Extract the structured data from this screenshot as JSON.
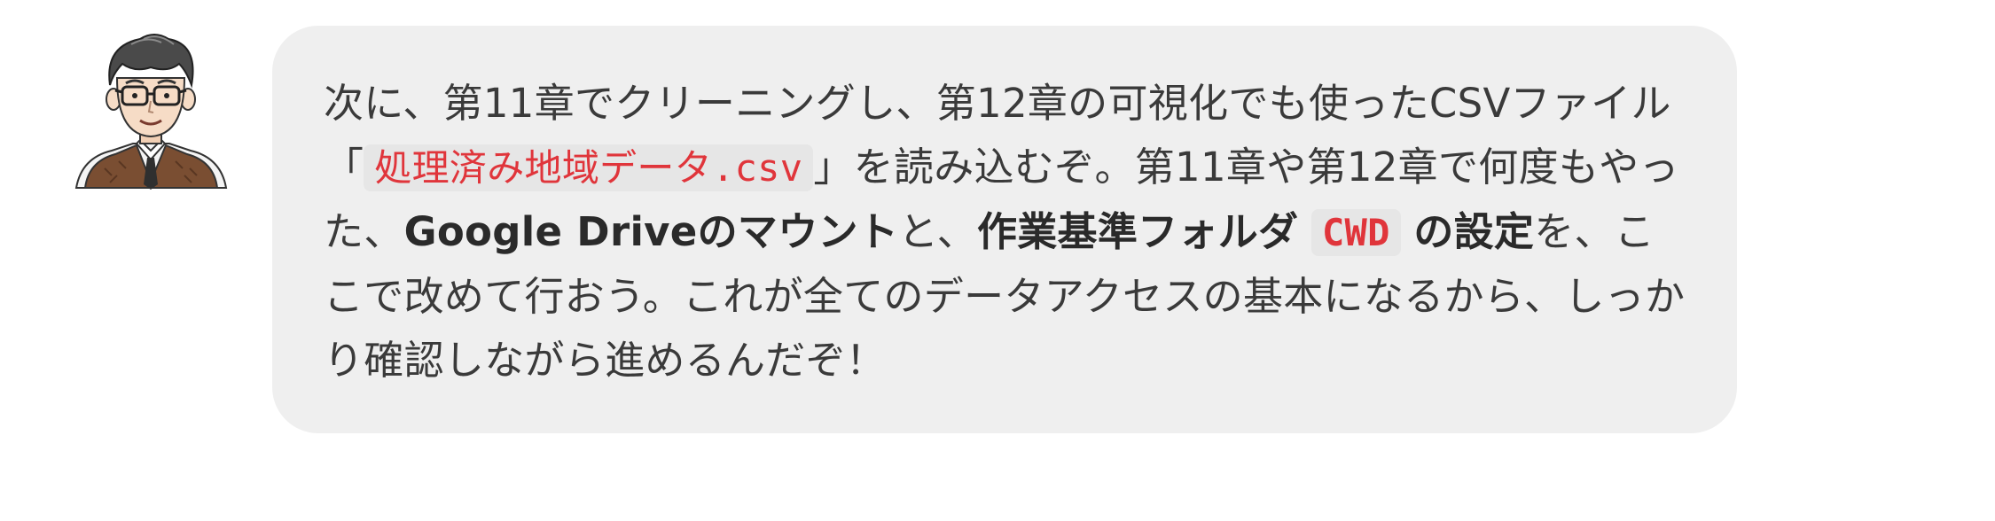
{
  "message": {
    "part1": "次に、第11章でクリーニングし、第12章の可視化でも使ったCSVファイル「",
    "filename_code": "処理済み地域データ.csv",
    "part2": "」を読み込むぞ。第11章や第12章で何度もやった、",
    "bold_drive_mount": "Google Driveのマウント",
    "part3": "と、",
    "bold_work_folder": "作業基準フォルダ",
    "cwd_code": "CWD",
    "bold_settings": "の設定",
    "part4": "を、ここで改めて行おう。これが全てのデータアクセスの基本になるから、しっかり確認しながら進めるんだぞ！"
  },
  "avatar": {
    "icon": "teacher-avatar-icon",
    "colors": {
      "hair": "#4a4a4a",
      "skin": "#f6dcc6",
      "vest": "#7a4e32",
      "tie": "#2f2f2f",
      "shirt": "#f4f4f4"
    }
  },
  "bubble_color": "#efefef",
  "code_color": "#e0353b"
}
